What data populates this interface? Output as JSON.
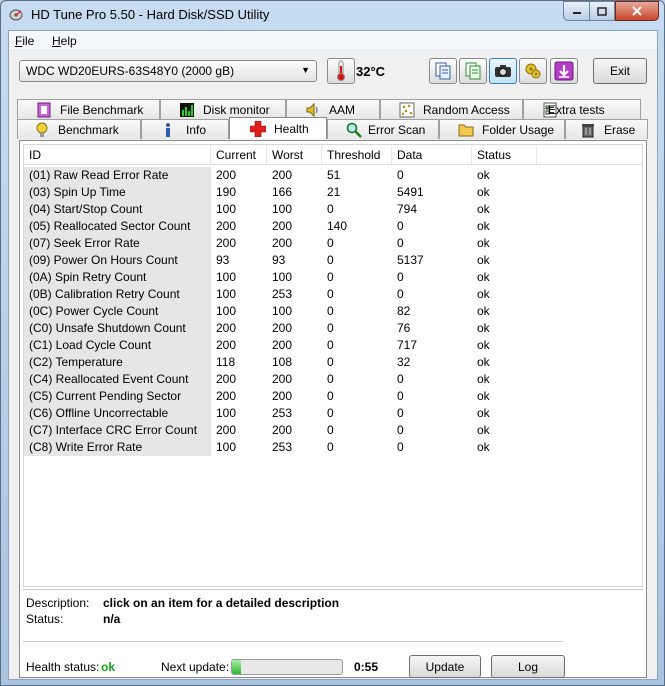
{
  "window": {
    "title": "HD Tune Pro 5.50 - Hard Disk/SSD Utility"
  },
  "menu": [
    {
      "label": "File",
      "underline": "F",
      "rest": "ile"
    },
    {
      "label": "Help",
      "underline": "H",
      "rest": "elp"
    }
  ],
  "toolbar": {
    "drive": "WDC WD20EURS-63S48Y0 (2000 gB)",
    "temperature": "32°C",
    "exit_label": "Exit",
    "icons": [
      "copy-info-icon",
      "copy-all-icon",
      "screenshot-camera-icon",
      "options-icon",
      "save-download-icon"
    ]
  },
  "tabs_top": [
    {
      "label": "File Benchmark",
      "icon": "file-benchmark-icon"
    },
    {
      "label": "Disk monitor",
      "icon": "disk-monitor-icon"
    },
    {
      "label": "AAM",
      "icon": "speaker-icon"
    },
    {
      "label": "Random Access",
      "icon": "random-access-icon"
    },
    {
      "label": "Extra tests",
      "icon": "extra-tests-icon"
    }
  ],
  "tabs_bottom": [
    {
      "label": "Benchmark",
      "icon": "benchmark-bulb-icon"
    },
    {
      "label": "Info",
      "icon": "info-icon"
    },
    {
      "label": "Health",
      "icon": "health-cross-icon",
      "active": true
    },
    {
      "label": "Error Scan",
      "icon": "magnifier-icon"
    },
    {
      "label": "Folder Usage",
      "icon": "folder-icon"
    },
    {
      "label": "Erase",
      "icon": "trash-icon"
    }
  ],
  "table": {
    "columns": [
      "ID",
      "Current",
      "Worst",
      "Threshold",
      "Data",
      "Status"
    ],
    "rows": [
      [
        "(01) Raw Read Error Rate",
        "200",
        "200",
        "51",
        "0",
        "ok"
      ],
      [
        "(03) Spin Up Time",
        "190",
        "166",
        "21",
        "5491",
        "ok"
      ],
      [
        "(04) Start/Stop Count",
        "100",
        "100",
        "0",
        "794",
        "ok"
      ],
      [
        "(05) Reallocated Sector Count",
        "200",
        "200",
        "140",
        "0",
        "ok"
      ],
      [
        "(07) Seek Error Rate",
        "200",
        "200",
        "0",
        "0",
        "ok"
      ],
      [
        "(09) Power On Hours Count",
        "93",
        "93",
        "0",
        "5137",
        "ok"
      ],
      [
        "(0A) Spin Retry Count",
        "100",
        "100",
        "0",
        "0",
        "ok"
      ],
      [
        "(0B) Calibration Retry Count",
        "100",
        "253",
        "0",
        "0",
        "ok"
      ],
      [
        "(0C) Power Cycle Count",
        "100",
        "100",
        "0",
        "82",
        "ok"
      ],
      [
        "(C0) Unsafe Shutdown Count",
        "200",
        "200",
        "0",
        "76",
        "ok"
      ],
      [
        "(C1) Load Cycle Count",
        "200",
        "200",
        "0",
        "717",
        "ok"
      ],
      [
        "(C2) Temperature",
        "118",
        "108",
        "0",
        "32",
        "ok"
      ],
      [
        "(C4) Reallocated Event Count",
        "200",
        "200",
        "0",
        "0",
        "ok"
      ],
      [
        "(C5) Current Pending Sector",
        "200",
        "200",
        "0",
        "0",
        "ok"
      ],
      [
        "(C6) Offline Uncorrectable",
        "100",
        "253",
        "0",
        "0",
        "ok"
      ],
      [
        "(C7) Interface CRC Error Count",
        "200",
        "200",
        "0",
        "0",
        "ok"
      ],
      [
        "(C8) Write Error Rate",
        "100",
        "253",
        "0",
        "0",
        "ok"
      ]
    ]
  },
  "description": {
    "desc_label": "Description:",
    "desc_value": "click on an item for a detailed description",
    "status_label": "Status:",
    "status_value": "n/a"
  },
  "footer": {
    "health_label": "Health status:",
    "health_value": "ok",
    "next_update_label": "Next update:",
    "progress_fraction": 0.08,
    "countdown": "0:55",
    "update_label": "Update",
    "log_label": "Log"
  },
  "colors": {
    "health_ok": "#17a017",
    "progress_green": "#2fb62f",
    "title_bar": "#c7dcf0"
  }
}
